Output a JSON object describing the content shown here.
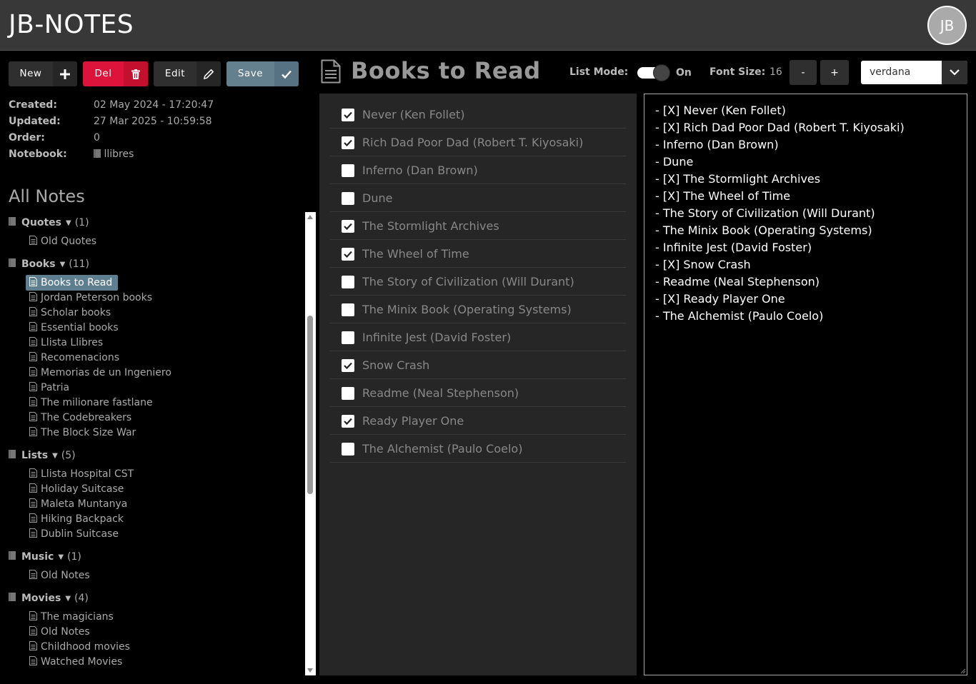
{
  "app": {
    "title": "JB-NOTES",
    "avatar_initials": "JB"
  },
  "toolbar": {
    "new_label": "New",
    "del_label": "Del",
    "edit_label": "Edit",
    "save_label": "Save"
  },
  "meta": {
    "created_label": "Created:",
    "created_value": "02 May 2024 - 17:20:47",
    "updated_label": "Updated:",
    "updated_value": "27 Mar 2025 - 10:59:58",
    "order_label": "Order:",
    "order_value": "0",
    "notebook_label": "Notebook:",
    "notebook_value": "llibres"
  },
  "sidebar": {
    "heading": "All Notes",
    "notebooks": [
      {
        "name": "Quotes",
        "count": "(1)",
        "notes": [
          "Old Quotes"
        ]
      },
      {
        "name": "Books",
        "count": "(11)",
        "notes": [
          "Books to Read",
          "Jordan Peterson books",
          "Scholar books",
          "Essential books",
          "Llista Llibres",
          "Recomenacions",
          "Memorias de un Ingeniero",
          "Patria",
          "The milionare fastlane",
          "The Codebreakers",
          "The Block Size War"
        ]
      },
      {
        "name": "Lists",
        "count": "(5)",
        "notes": [
          "Llista Hospital CST",
          "Holiday Suitcase",
          "Maleta Muntanya",
          "Hiking Backpack",
          "Dublin Suitcase"
        ]
      },
      {
        "name": "Music",
        "count": "(1)",
        "notes": [
          "Old Notes"
        ]
      },
      {
        "name": "Movies",
        "count": "(4)",
        "notes": [
          "The magicians",
          "Old Notes",
          "Childhood movies",
          "Watched Movies"
        ]
      }
    ],
    "selected_note": "Books to Read"
  },
  "editor": {
    "title": "Books to Read",
    "list_mode_label": "List Mode:",
    "list_mode_state": "On",
    "font_size_label": "Font Size:",
    "font_size_value": "16",
    "font_minus": "-",
    "font_plus": "+",
    "font_family": "verdana"
  },
  "checklist": [
    {
      "text": "Never (Ken Follet)",
      "checked": true
    },
    {
      "text": "Rich Dad Poor Dad (Robert T. Kiyosaki)",
      "checked": true
    },
    {
      "text": "Inferno (Dan Brown)",
      "checked": false
    },
    {
      "text": "Dune",
      "checked": false
    },
    {
      "text": "The Stormlight Archives",
      "checked": true
    },
    {
      "text": "The Wheel of Time",
      "checked": true
    },
    {
      "text": "The Story of Civilization (Will Durant)",
      "checked": false
    },
    {
      "text": "The Minix Book (Operating Systems)",
      "checked": false
    },
    {
      "text": "Infinite Jest (David Foster)",
      "checked": false
    },
    {
      "text": "Snow Crash",
      "checked": true
    },
    {
      "text": "Readme (Neal Stephenson)",
      "checked": false
    },
    {
      "text": "Ready Player One",
      "checked": true
    },
    {
      "text": "The Alchemist (Paulo Coelo)",
      "checked": false
    }
  ],
  "raw_text": [
    "- [X] Never (Ken Follet)",
    "- [X] Rich Dad Poor Dad (Robert T. Kiyosaki)",
    "- Inferno (Dan Brown)",
    "- Dune",
    "- [X] The Stormlight Archives",
    "- [X] The Wheel of Time",
    "- The Story of Civilization (Will Durant)",
    "- The Minix Book (Operating Systems)",
    "- Infinite Jest (David Foster)",
    "- [X] Snow Crash",
    "- Readme (Neal Stephenson)",
    "- [X] Ready Player One",
    "- The Alchemist (Paulo Coelo)"
  ]
}
